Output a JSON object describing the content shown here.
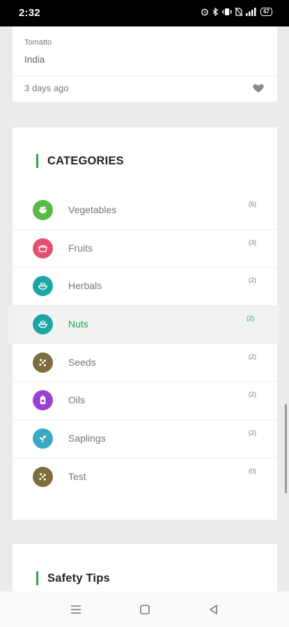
{
  "status_bar": {
    "time": "2:32",
    "battery": "67",
    "icons": [
      "alarm-icon",
      "bluetooth-icon",
      "vibrate-icon",
      "no-sim-icon",
      "signal-icon",
      "battery-icon"
    ]
  },
  "listing": {
    "product": "Tomatto",
    "country": "India",
    "posted": "3 days ago",
    "favorite_icon": "heart-icon"
  },
  "categories": {
    "title": "CATEGORIES",
    "accent_color": "#22a845",
    "items": [
      {
        "label": "Vegetables",
        "count": "(5)",
        "icon": "vegetables-icon",
        "color": "#5ab947"
      },
      {
        "label": "Fruits",
        "count": "(3)",
        "icon": "fruits-icon",
        "color": "#e84e72"
      },
      {
        "label": "Herbals",
        "count": "(2)",
        "icon": "herbals-icon",
        "color": "#1aa6a3"
      },
      {
        "label": "Nuts",
        "count": "(2)",
        "icon": "nuts-icon",
        "color": "#1aa6a3",
        "active": true
      },
      {
        "label": "Seeds",
        "count": "(2)",
        "icon": "seeds-icon",
        "color": "#7d6e3c"
      },
      {
        "label": "Oils",
        "count": "(2)",
        "icon": "oils-icon",
        "color": "#9b3fd1"
      },
      {
        "label": "Saplings",
        "count": "(2)",
        "icon": "saplings-icon",
        "color": "#3aa9c4"
      },
      {
        "label": "Test",
        "count": "(0)",
        "icon": "test-icon",
        "color": "#7d6e3c"
      }
    ]
  },
  "safety": {
    "title": "Safety Tips"
  },
  "nav_bar": {
    "buttons": [
      "menu-icon",
      "home-icon",
      "back-icon"
    ]
  }
}
